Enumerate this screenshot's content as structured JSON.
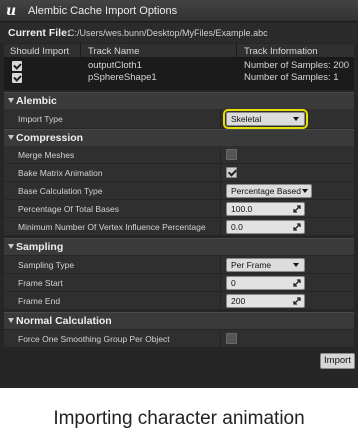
{
  "window": {
    "title": "Alembic Cache Import Options",
    "logo_icon": "unreal-logo-icon"
  },
  "current_file": {
    "label": "Current File:",
    "path": "C:/Users/wes.bunn/Desktop/MyFiles/Example.abc"
  },
  "track_table": {
    "columns": [
      "Should Import",
      "Track Name",
      "Track Information"
    ],
    "rows": [
      {
        "should_import": true,
        "name": "outputCloth1",
        "info": "Number of Samples: 200"
      },
      {
        "should_import": true,
        "name": "pSphereShape1",
        "info": "Number of Samples: 1"
      }
    ]
  },
  "sections": {
    "alembic": {
      "label": "Alembic",
      "import_type": {
        "label": "Import Type",
        "value": "Skeletal"
      }
    },
    "compression": {
      "label": "Compression",
      "merge_meshes": {
        "label": "Merge Meshes",
        "checked": false
      },
      "bake_matrix": {
        "label": "Bake Matrix Animation",
        "checked": true
      },
      "base_calc": {
        "label": "Base Calculation Type",
        "value": "Percentage Based"
      },
      "pct_bases": {
        "label": "Percentage Of Total Bases",
        "value": "100.0"
      },
      "min_vertex": {
        "label": "Minimum Number Of Vertex Influence Percentage",
        "value": "0.0"
      }
    },
    "sampling": {
      "label": "Sampling",
      "sampling_type": {
        "label": "Sampling Type",
        "value": "Per Frame"
      },
      "frame_start": {
        "label": "Frame Start",
        "value": "0"
      },
      "frame_end": {
        "label": "Frame End",
        "value": "200"
      }
    },
    "normal_calc": {
      "label": "Normal Calculation",
      "force_one_group": {
        "label": "Force One Smoothing Group Per Object",
        "checked": false
      }
    }
  },
  "actions": {
    "import_label": "Import"
  },
  "caption": "Importing character animation",
  "colors": {
    "highlight": "#e6e000",
    "background": "#262626"
  }
}
